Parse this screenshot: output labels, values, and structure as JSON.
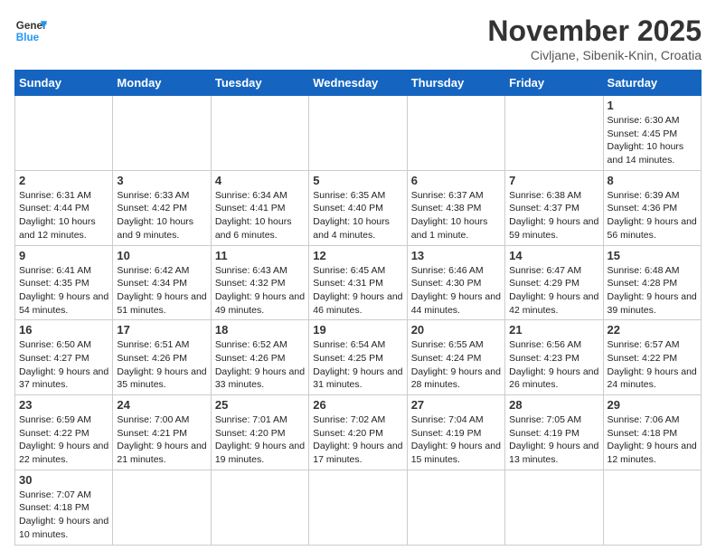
{
  "header": {
    "logo_general": "General",
    "logo_blue": "Blue",
    "month_title": "November 2025",
    "location": "Civljane, Sibenik-Knin, Croatia"
  },
  "weekdays": [
    "Sunday",
    "Monday",
    "Tuesday",
    "Wednesday",
    "Thursday",
    "Friday",
    "Saturday"
  ],
  "weeks": [
    [
      {
        "day": "",
        "info": ""
      },
      {
        "day": "",
        "info": ""
      },
      {
        "day": "",
        "info": ""
      },
      {
        "day": "",
        "info": ""
      },
      {
        "day": "",
        "info": ""
      },
      {
        "day": "",
        "info": ""
      },
      {
        "day": "1",
        "info": "Sunrise: 6:30 AM\nSunset: 4:45 PM\nDaylight: 10 hours and 14 minutes."
      }
    ],
    [
      {
        "day": "2",
        "info": "Sunrise: 6:31 AM\nSunset: 4:44 PM\nDaylight: 10 hours and 12 minutes."
      },
      {
        "day": "3",
        "info": "Sunrise: 6:33 AM\nSunset: 4:42 PM\nDaylight: 10 hours and 9 minutes."
      },
      {
        "day": "4",
        "info": "Sunrise: 6:34 AM\nSunset: 4:41 PM\nDaylight: 10 hours and 6 minutes."
      },
      {
        "day": "5",
        "info": "Sunrise: 6:35 AM\nSunset: 4:40 PM\nDaylight: 10 hours and 4 minutes."
      },
      {
        "day": "6",
        "info": "Sunrise: 6:37 AM\nSunset: 4:38 PM\nDaylight: 10 hours and 1 minute."
      },
      {
        "day": "7",
        "info": "Sunrise: 6:38 AM\nSunset: 4:37 PM\nDaylight: 9 hours and 59 minutes."
      },
      {
        "day": "8",
        "info": "Sunrise: 6:39 AM\nSunset: 4:36 PM\nDaylight: 9 hours and 56 minutes."
      }
    ],
    [
      {
        "day": "9",
        "info": "Sunrise: 6:41 AM\nSunset: 4:35 PM\nDaylight: 9 hours and 54 minutes."
      },
      {
        "day": "10",
        "info": "Sunrise: 6:42 AM\nSunset: 4:34 PM\nDaylight: 9 hours and 51 minutes."
      },
      {
        "day": "11",
        "info": "Sunrise: 6:43 AM\nSunset: 4:32 PM\nDaylight: 9 hours and 49 minutes."
      },
      {
        "day": "12",
        "info": "Sunrise: 6:45 AM\nSunset: 4:31 PM\nDaylight: 9 hours and 46 minutes."
      },
      {
        "day": "13",
        "info": "Sunrise: 6:46 AM\nSunset: 4:30 PM\nDaylight: 9 hours and 44 minutes."
      },
      {
        "day": "14",
        "info": "Sunrise: 6:47 AM\nSunset: 4:29 PM\nDaylight: 9 hours and 42 minutes."
      },
      {
        "day": "15",
        "info": "Sunrise: 6:48 AM\nSunset: 4:28 PM\nDaylight: 9 hours and 39 minutes."
      }
    ],
    [
      {
        "day": "16",
        "info": "Sunrise: 6:50 AM\nSunset: 4:27 PM\nDaylight: 9 hours and 37 minutes."
      },
      {
        "day": "17",
        "info": "Sunrise: 6:51 AM\nSunset: 4:26 PM\nDaylight: 9 hours and 35 minutes."
      },
      {
        "day": "18",
        "info": "Sunrise: 6:52 AM\nSunset: 4:26 PM\nDaylight: 9 hours and 33 minutes."
      },
      {
        "day": "19",
        "info": "Sunrise: 6:54 AM\nSunset: 4:25 PM\nDaylight: 9 hours and 31 minutes."
      },
      {
        "day": "20",
        "info": "Sunrise: 6:55 AM\nSunset: 4:24 PM\nDaylight: 9 hours and 28 minutes."
      },
      {
        "day": "21",
        "info": "Sunrise: 6:56 AM\nSunset: 4:23 PM\nDaylight: 9 hours and 26 minutes."
      },
      {
        "day": "22",
        "info": "Sunrise: 6:57 AM\nSunset: 4:22 PM\nDaylight: 9 hours and 24 minutes."
      }
    ],
    [
      {
        "day": "23",
        "info": "Sunrise: 6:59 AM\nSunset: 4:22 PM\nDaylight: 9 hours and 22 minutes."
      },
      {
        "day": "24",
        "info": "Sunrise: 7:00 AM\nSunset: 4:21 PM\nDaylight: 9 hours and 21 minutes."
      },
      {
        "day": "25",
        "info": "Sunrise: 7:01 AM\nSunset: 4:20 PM\nDaylight: 9 hours and 19 minutes."
      },
      {
        "day": "26",
        "info": "Sunrise: 7:02 AM\nSunset: 4:20 PM\nDaylight: 9 hours and 17 minutes."
      },
      {
        "day": "27",
        "info": "Sunrise: 7:04 AM\nSunset: 4:19 PM\nDaylight: 9 hours and 15 minutes."
      },
      {
        "day": "28",
        "info": "Sunrise: 7:05 AM\nSunset: 4:19 PM\nDaylight: 9 hours and 13 minutes."
      },
      {
        "day": "29",
        "info": "Sunrise: 7:06 AM\nSunset: 4:18 PM\nDaylight: 9 hours and 12 minutes."
      }
    ],
    [
      {
        "day": "30",
        "info": "Sunrise: 7:07 AM\nSunset: 4:18 PM\nDaylight: 9 hours and 10 minutes."
      },
      {
        "day": "",
        "info": ""
      },
      {
        "day": "",
        "info": ""
      },
      {
        "day": "",
        "info": ""
      },
      {
        "day": "",
        "info": ""
      },
      {
        "day": "",
        "info": ""
      },
      {
        "day": "",
        "info": ""
      }
    ]
  ]
}
